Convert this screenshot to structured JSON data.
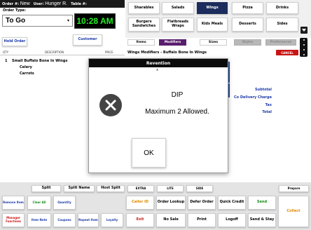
{
  "header": {
    "order_label": "Order #:",
    "order_value": "New",
    "user_label": "User:",
    "user_value": "Hunger R.",
    "table_label": "Table #:",
    "table_value": ""
  },
  "order_type": {
    "label": "Order Type:",
    "value": "To Go"
  },
  "clock": "10:28 AM",
  "buttons": {
    "hold_order": "Hold Order",
    "customer": "Customer"
  },
  "columns": {
    "qty": "QTY",
    "description": "DESCRIPTION",
    "price": "PRICE"
  },
  "order_items": [
    {
      "qty": "1",
      "name": "Small Buffalo Bone In Wings"
    },
    {
      "qty": "",
      "name": "Celery"
    },
    {
      "qty": "",
      "name": "Carrots"
    }
  ],
  "totals": {
    "subtotal": "Subtotal",
    "delivery": "Co Delivery Charge",
    "tax": "Tax",
    "total": "Total"
  },
  "categories": {
    "row1": [
      "Sharables",
      "Salads",
      "Wings",
      "Pizza",
      "Drinks"
    ],
    "row2": [
      "Burgers Sandwiches",
      "Flatbreads Wraps",
      "Kids Meals",
      "Desserts",
      "Sides"
    ],
    "selected": "Wings"
  },
  "tabs": {
    "items": "Items",
    "modifiers": "Modifiers",
    "sizes": "Sizes",
    "styles": "Styles",
    "preferences": "Preferences"
  },
  "modifiers_header": "Wings Modifiers - Buffalo Bone In Wings",
  "cancel": "CANCEL",
  "dialog": {
    "title": "Revention",
    "hint": "▲",
    "line1": "DIP",
    "line2": "Maximum 2 Allowed.",
    "ok": "OK"
  },
  "bottom": {
    "split": "Split",
    "split_name": "Split Name",
    "host_split": "Host Split",
    "extra": "EXTRA",
    "lite": "LITE",
    "side": "SIDE",
    "prepare": "Prepare",
    "remove_item": "Remove Item",
    "clear_all": "Clear All",
    "quantity": "Quantity",
    "caller_id": "Caller ID",
    "order_lookup": "Order Lookup",
    "defer_order": "Defer Order",
    "quick_credit": "Quick Credit",
    "send": "Send",
    "collect": "Collect",
    "manager_functions": "Manager Functions",
    "item_note": "Item Note",
    "coupons": "Coupons",
    "repeat_item": "Repeat Item",
    "loyalty": "Loyalty",
    "exit": "Exit",
    "no_sale": "No Sale",
    "print": "Print",
    "logoff": "Logoff",
    "send_stay": "Send & Stay"
  },
  "colors": {
    "accent_blue": "#1c3aa8",
    "selected_category": "#1c2c5c",
    "selected_tab": "#5a1e6e",
    "clock_green": "#22ee22",
    "cancel_red": "#c81414"
  }
}
